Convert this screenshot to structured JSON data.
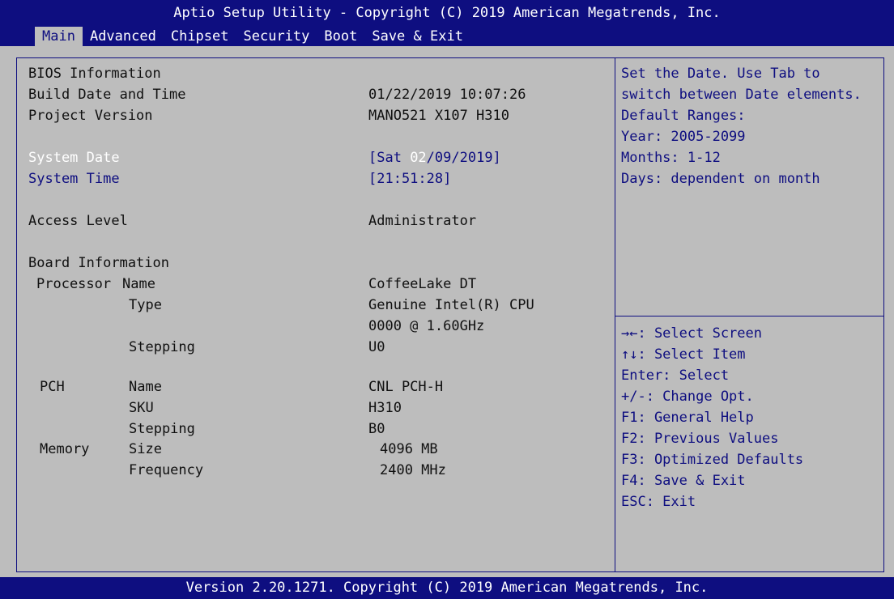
{
  "header": {
    "title": "Aptio Setup Utility - Copyright (C) 2019 American Megatrends, Inc.",
    "tabs": [
      "Main",
      "Advanced",
      "Chipset",
      "Security",
      "Boot",
      "Save & Exit"
    ],
    "active_tab": "Main"
  },
  "main": {
    "bios_info_heading": "BIOS Information",
    "build_date_label": "Build Date and Time",
    "build_date_value": "01/22/2019 10:07:26",
    "project_version_label": "Project Version",
    "project_version_value": "MANO521 X107 H310",
    "system_date_label": "System Date",
    "system_date_prefix": "[Sat ",
    "system_date_month": "02",
    "system_date_suffix": "/09/2019]",
    "system_time_label": "System Time",
    "system_time_value": "[21:51:28]",
    "access_level_label": "Access Level",
    "access_level_value": "Administrator",
    "board_info_heading": "Board Information",
    "processor_label": "Processor",
    "proc_name_label": "Name",
    "proc_name_value": "CoffeeLake DT",
    "proc_type_label": "Type",
    "proc_type_value_1": "Genuine Intel(R) CPU",
    "proc_type_value_2": "0000 @ 1.60GHz",
    "proc_stepping_label": "Stepping",
    "proc_stepping_value": "U0",
    "pch_label": "PCH",
    "pch_name_label": "Name",
    "pch_name_value": "CNL PCH-H",
    "pch_sku_label": "SKU",
    "pch_sku_value": "H310",
    "pch_stepping_label": "Stepping",
    "pch_stepping_value": "B0",
    "memory_label": "Memory",
    "mem_size_label": "Size",
    "mem_size_value": "4096 MB",
    "mem_freq_label": "Frequency",
    "mem_freq_value": "2400 MHz"
  },
  "help": {
    "lines": [
      "Set the Date. Use Tab to",
      "switch between Date elements.",
      "Default Ranges:",
      "Year: 2005-2099",
      "Months: 1-12",
      "Days: dependent on month"
    ]
  },
  "keys": {
    "lines": [
      "→←: Select Screen",
      "↑↓: Select Item",
      "Enter: Select",
      "+/-: Change Opt.",
      "F1: General Help",
      "F2: Previous Values",
      "F3: Optimized Defaults",
      "F4: Save & Exit",
      "ESC: Exit"
    ]
  },
  "footer": {
    "version": "Version 2.20.1271. Copyright (C) 2019 American Megatrends, Inc."
  },
  "colors": {
    "bar_blue": "#0e0e80",
    "panel_gray": "#bdbdbd",
    "highlight_white": "#ffffff"
  }
}
